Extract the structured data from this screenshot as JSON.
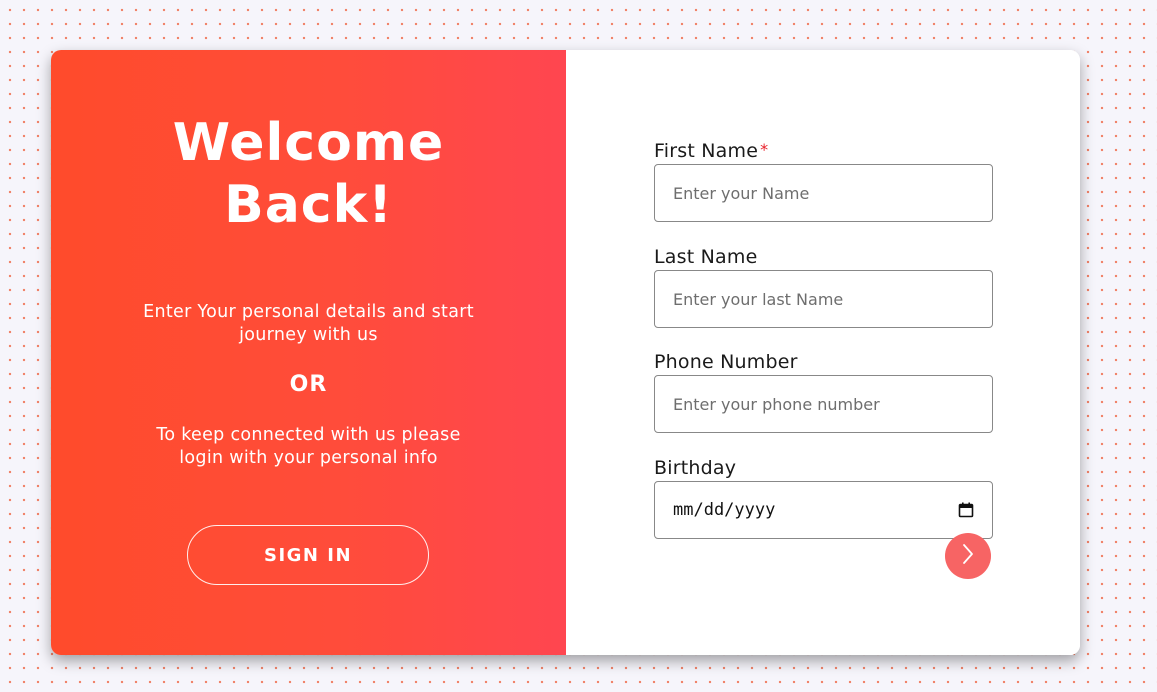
{
  "colors": {
    "accent": "#ff4b2b",
    "accent_end": "#ff4650",
    "next_button": "#f76464",
    "required_mark": "#e8202a"
  },
  "left": {
    "title_line1": "Welcome",
    "title_line2": "Back!",
    "description_1": "Enter Your personal details and start journey with us",
    "or": "OR",
    "description_2": "To keep connected with us please login with your personal info",
    "signin_label": "SIGN IN"
  },
  "form": {
    "first_name": {
      "label": "First Name",
      "required_mark": "*",
      "placeholder": "Enter your Name",
      "value": ""
    },
    "last_name": {
      "label": "Last Name",
      "placeholder": "Enter your last Name",
      "value": ""
    },
    "phone": {
      "label": "Phone Number",
      "placeholder": "Enter your phone number",
      "value": ""
    },
    "birthday": {
      "label": "Birthday",
      "placeholder": "mm/dd/yyyy",
      "icon": "calendar-icon"
    },
    "next_icon": "chevron-right-icon"
  }
}
